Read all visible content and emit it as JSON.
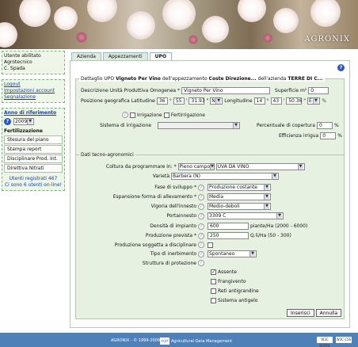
{
  "header": {
    "logo": "AGRONIX"
  },
  "sidebar": {
    "user_label": "Utente abilitato",
    "user_role": "Agrotecnico",
    "user_name": "C. Spada",
    "links": [
      "Logout",
      "Impostazioni account",
      "Segnalazione"
    ],
    "year_title": "Anno di riferimento",
    "year_value": "2009",
    "fert_title": "Fertilizzazione",
    "fert_items": [
      "Stesura del piano",
      "Stampa report",
      "Disciplinare Prod. Int.",
      "Direttiva Nitrati"
    ],
    "online_1": "Utenti registrati 467",
    "online_2": "Ci sono 6 utenti on-line!"
  },
  "tabs": [
    "Azienda",
    "Appezzamenti",
    "UPO"
  ],
  "detail": {
    "legend_prefix": "Dettaglio UPO",
    "legend_upo": "Vigneto Per Vino",
    "legend_mid": "dell'appezzamento",
    "legend_app": "Coste Direzione...",
    "legend_mid2": "dell'azienda",
    "legend_az": "TERRE DI C...",
    "desc_label": "Descrizione Unità Produttiva Omogenea *",
    "desc_value": "Vigneto Per Vino",
    "sup_label": "Superficie m²",
    "sup_value": "0",
    "pos_label": "Posizione geografica",
    "lat_label": "Latitudine",
    "lat_deg": "36",
    "lat_min": "55",
    "lat_sec": "31.93",
    "lat_dir": "N",
    "lon_label": "Longitudine",
    "lon_deg": "14",
    "lon_min": "43",
    "lon_sec": "50.36",
    "lon_dir": "E",
    "irr_label": "Irrigazione",
    "fert_label": "Fertirrigazione",
    "sist_label": "Sistema di irrigazione",
    "perc_label": "Percentuale di copertura",
    "perc_value": "0",
    "perc_unit": "%",
    "eff_label": "Efficienza irrigua",
    "eff_value": "0",
    "eff_unit": "%"
  },
  "tecno": {
    "legend": "Dati tecno-agronomici",
    "coltura_label": "Coltura da programmare in: *",
    "coltura_mode": "Pieno campo",
    "coltura_value": "UVA DA VINO",
    "varieta_label": "Varietà",
    "varieta_value": "Barbera (N)",
    "fase_label": "Fase di sviluppo *",
    "fase_value": "Produzione costante",
    "espans_label": "Espansione forma di allevamento *",
    "espans_value": "Media",
    "vigoria_label": "Vigoria dell'innesto",
    "vigoria_value": "Medio-deboli",
    "portinnesto_label": "Portainnesto",
    "portinnesto_value": "3309 C",
    "densita_label": "Densità di impianto",
    "densita_value": "600",
    "densita_unit": "piante/Ha (2000 - 6000)",
    "produzione_label": "Produzione prevista *",
    "produzione_value": "250",
    "produzione_unit": "Q.li/Ha (50 - 300)",
    "disciplinare_label": "Produzione soggetta a disciplinare",
    "inerbimento_label": "Tipo di inerbimento",
    "inerbimento_value": "Spontaneo",
    "struttura_label": "Struttura di protezione",
    "protezioni": [
      "Assente",
      "Frangivento",
      "Reti antigrandine",
      "Sistema antigelo"
    ],
    "btn_insert": "Inserisci",
    "btn_cancel": "Annulla"
  },
  "footer": {
    "copyright": "AGRONIX - © 1999-2009",
    "aqm": "AQM",
    "adm": "Agricultural Data Management",
    "badge1": "W3C XHTML",
    "badge2": "W3C CSS"
  }
}
